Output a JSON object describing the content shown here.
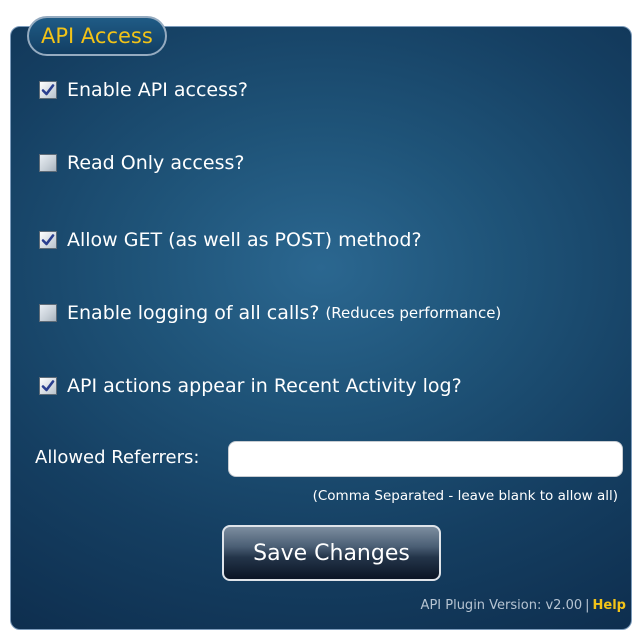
{
  "section": {
    "legend": "API Access"
  },
  "options": [
    {
      "label": "Enable API access?",
      "note": "",
      "checked": true
    },
    {
      "label": "Read Only access?",
      "note": "",
      "checked": false
    },
    {
      "label": "Allow GET (as well as POST) method?",
      "note": "",
      "checked": true
    },
    {
      "label": "Enable logging of all calls?",
      "note": "(Reduces performance)",
      "checked": false
    },
    {
      "label": "API actions appear in Recent Activity log?",
      "note": "",
      "checked": true
    }
  ],
  "referrers": {
    "label": "Allowed Referrers:",
    "value": "",
    "hint": "(Comma Separated - leave blank to allow all)"
  },
  "save_button": {
    "label": "Save Changes"
  },
  "footer": {
    "version": "API Plugin Version: v2.00",
    "separator": "|",
    "help": "Help"
  },
  "colors": {
    "panel_background": "#1f5479",
    "legend_text": "#f2c318",
    "help_link": "#f2c318",
    "text": "#ffffff"
  }
}
